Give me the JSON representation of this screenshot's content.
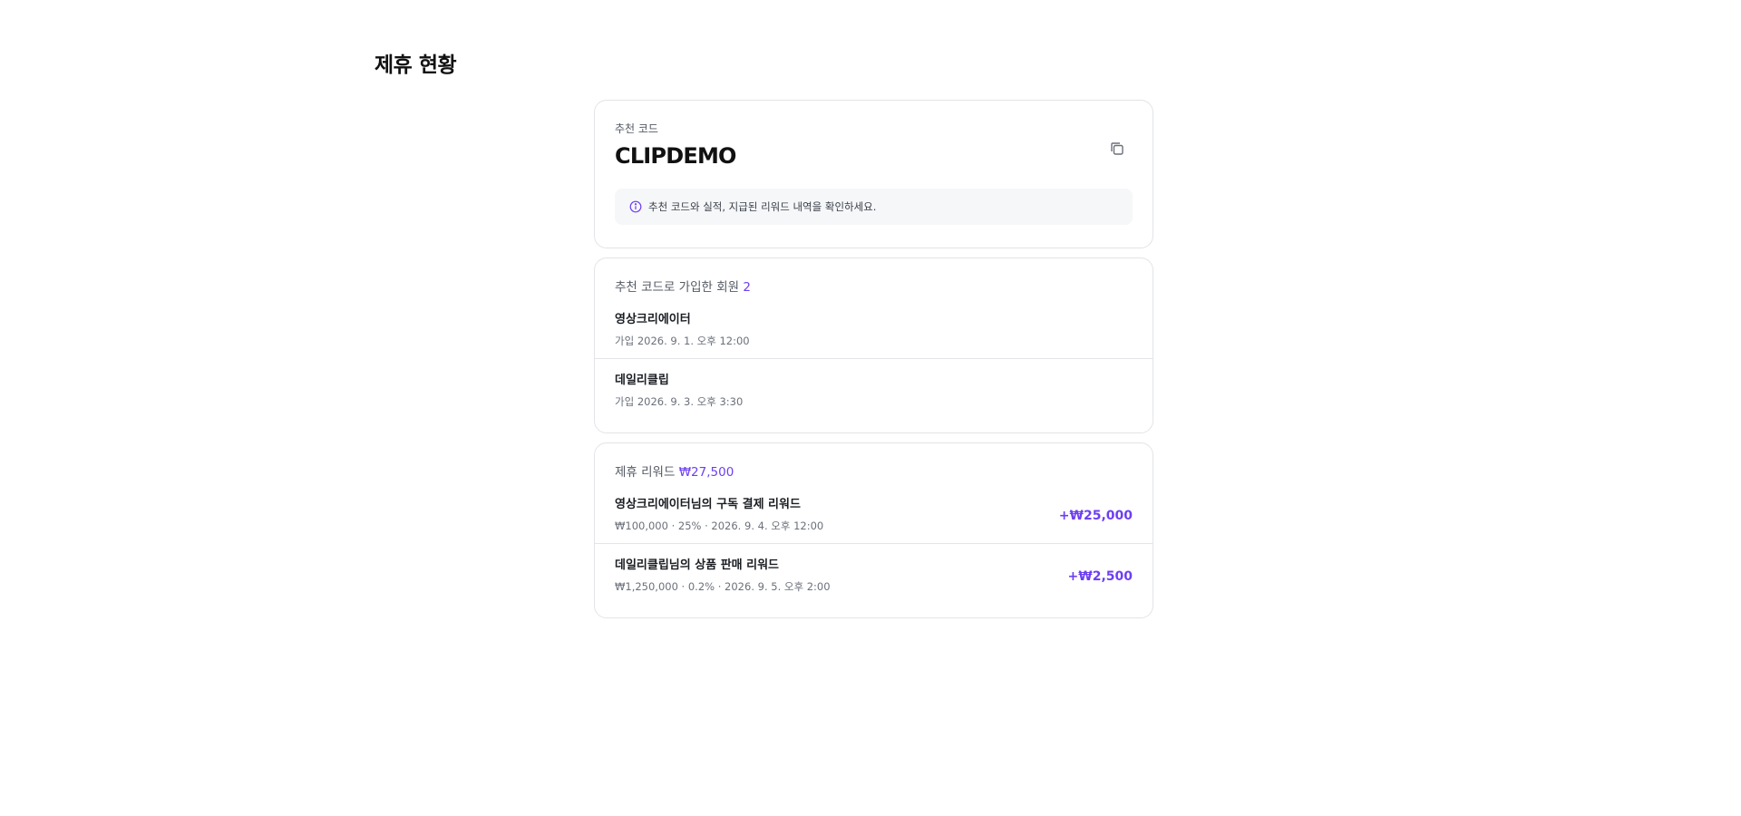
{
  "page": {
    "title": "제휴 현황"
  },
  "referral": {
    "label": "추천 코드",
    "code": "CLIPDEMO",
    "copy_icon": "copy-icon",
    "info_icon": "info-circle-icon",
    "info_text": "추천 코드와 실적, 지급된 리워드 내역을 확인하세요."
  },
  "members": {
    "heading": "추천 코드로 가입한 회원",
    "count": "2",
    "items": [
      {
        "name": "영상크리에이터",
        "joined": "가입 2026. 9. 1. 오후 12:00"
      },
      {
        "name": "데일리클립",
        "joined": "가입 2026. 9. 3. 오후 3:30"
      }
    ]
  },
  "rewards": {
    "heading": "제휴 리워드",
    "total": "₩27,500",
    "items": [
      {
        "title": "영상크리에이터님의 구독 결제 리워드",
        "detail": "₩100,000 · 25% · 2026. 9. 4. 오후 12:00",
        "amount": "+₩25,000"
      },
      {
        "title": "데일리클립님의 상품 판매 리워드",
        "detail": "₩1,250,000 · 0.2% · 2026. 9. 5. 오후 2:00",
        "amount": "+₩2,500"
      }
    ]
  },
  "colors": {
    "accent": "#6d3ff2",
    "border": "#e3e4e8",
    "info_bg": "#f6f7f9"
  }
}
